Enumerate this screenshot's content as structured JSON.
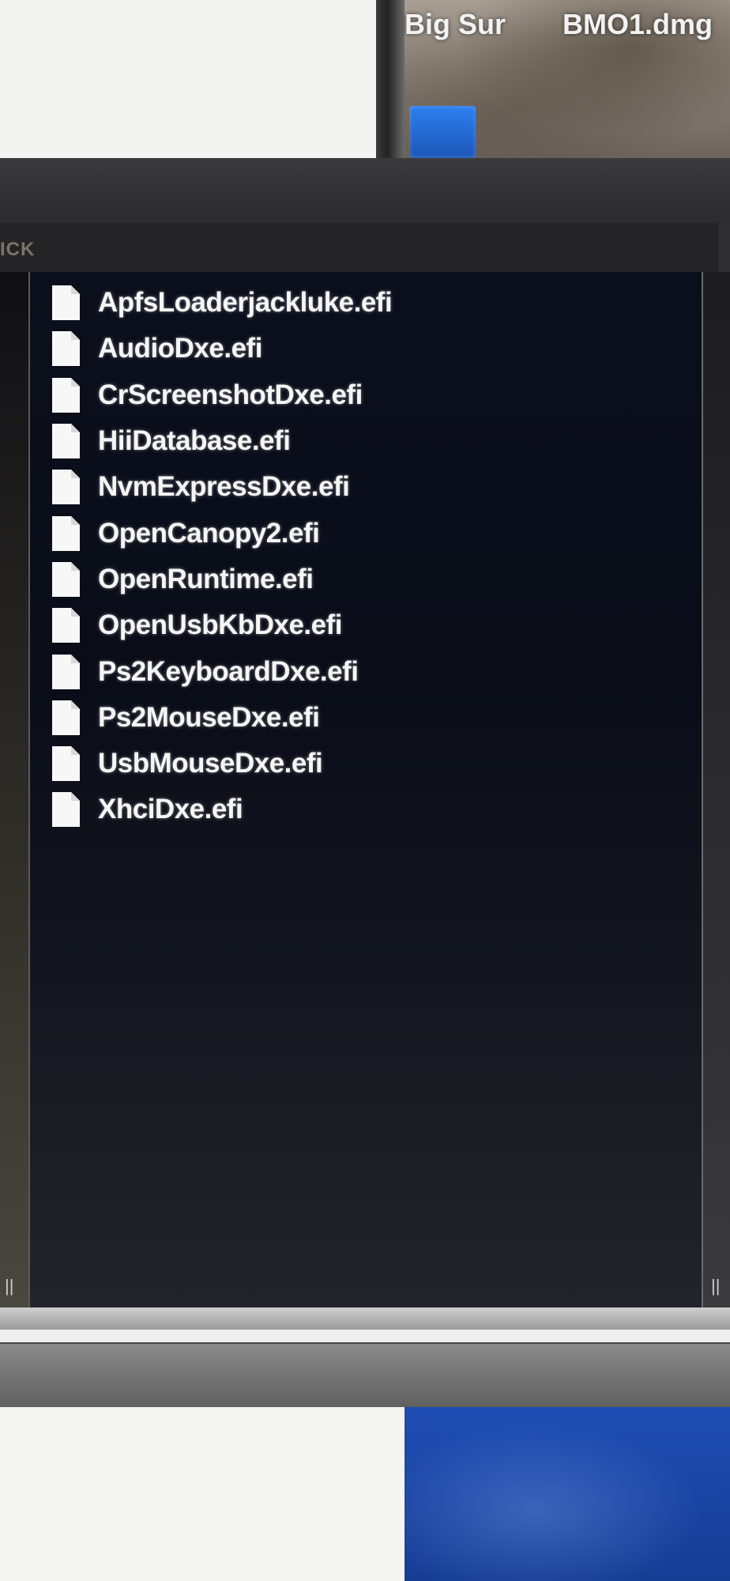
{
  "desktop": {
    "items": [
      {
        "label": "Big Sur"
      },
      {
        "label": "BMO1.dmg"
      }
    ]
  },
  "window": {
    "path_label": "ICK",
    "files": [
      {
        "name": "ApfsLoaderjackluke.efi"
      },
      {
        "name": "AudioDxe.efi"
      },
      {
        "name": "CrScreenshotDxe.efi"
      },
      {
        "name": "HiiDatabase.efi"
      },
      {
        "name": "NvmExpressDxe.efi"
      },
      {
        "name": "OpenCanopy2.efi"
      },
      {
        "name": "OpenRuntime.efi"
      },
      {
        "name": "OpenUsbKbDxe.efi"
      },
      {
        "name": "Ps2KeyboardDxe.efi"
      },
      {
        "name": "Ps2MouseDxe.efi"
      },
      {
        "name": "UsbMouseDxe.efi"
      },
      {
        "name": "XhciDxe.efi"
      }
    ],
    "file_icon": "document-icon",
    "resize_handle_glyph": "||"
  },
  "colors": {
    "window_bg": "#2f2f31",
    "file_column_bg": "#0b0f1c",
    "file_text": "#f5f5f5",
    "desktop_blue": "#1f4db4"
  }
}
